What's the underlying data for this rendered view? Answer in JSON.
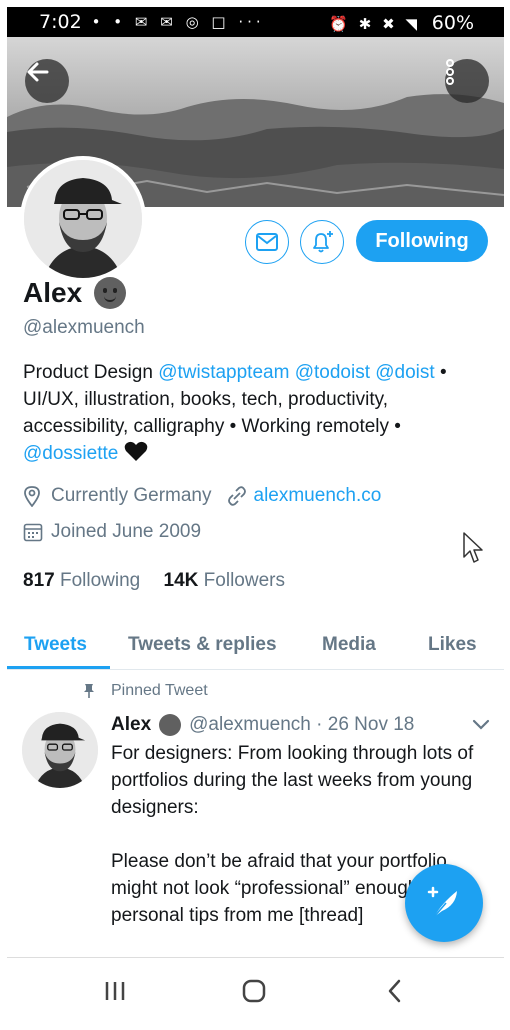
{
  "status_bar": {
    "time": "7:02",
    "left_icons": "• • ✉ ✉ ◎ □  ···",
    "right_icons": "⏰ ✱ ✖ ◥",
    "battery": "60%"
  },
  "profile": {
    "name": "Alex",
    "handle": "@alexmuench",
    "follow_button": "Following",
    "bio_plain_1": "Product Design ",
    "bio_link_1": "@twistappteam",
    "bio_link_2": "@todoist",
    "bio_link_3": "@doist",
    "bio_plain_2": "• UI/UX, illustration, books, tech, productivity, accessibility, calligraphy • Working remotely • ",
    "bio_link_4": "@dossiette",
    "location": "Currently Germany",
    "website": "alexmuench.co",
    "joined": "Joined June 2009",
    "following_count": "817",
    "following_label": "Following",
    "followers_count": "14K",
    "followers_label": "Followers"
  },
  "tabs": [
    {
      "label": "Tweets",
      "active": true
    },
    {
      "label": "Tweets & replies",
      "active": false
    },
    {
      "label": "Media",
      "active": false
    },
    {
      "label": "Likes",
      "active": false
    }
  ],
  "pinned_tweet": {
    "pinned_label": "Pinned Tweet",
    "author": "Alex",
    "handle_date": "@alexmuench · 26 Nov 18",
    "text": "For designers: From looking through lots of portfolios during the last weeks from young designers:\n\nPlease don’t be afraid that your portfolio might not look “professional” enough. A few personal tips from me [thread]"
  },
  "colors": {
    "accent": "#1da1f2",
    "secondary_text": "#657786"
  }
}
